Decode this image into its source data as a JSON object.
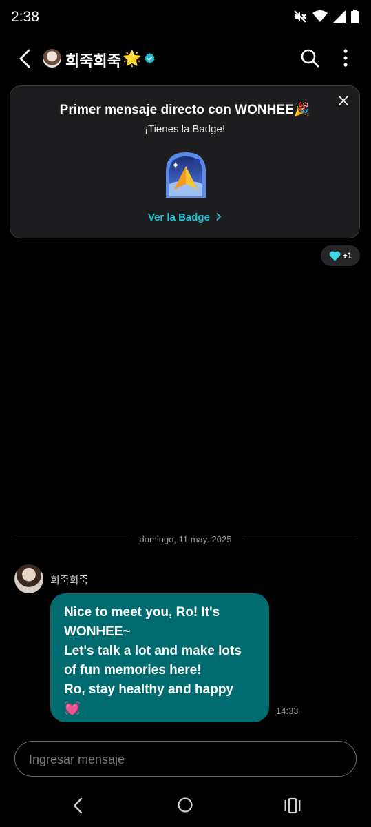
{
  "status_bar": {
    "time": "2:38",
    "icons": [
      "mute-icon",
      "wifi-icon",
      "signal-icon",
      "battery-icon"
    ]
  },
  "header": {
    "title": "희죽희죽",
    "title_emoji": "🌟",
    "icons": [
      "back-icon",
      "verified-icon",
      "search-icon",
      "more-vertical-icon"
    ]
  },
  "badge_card": {
    "title": "Primer mensaje directo con WONHEE🎉",
    "subtitle": "¡Tienes la Badge!",
    "link_label": "Ver la Badge",
    "link_color": "#20c6d6",
    "badge_icon": "paper-plane-badge-icon"
  },
  "reaction": {
    "emoji_icon": "heart-icon",
    "emoji_color": "#3fd6e6",
    "count": "+1"
  },
  "date_divider": "domingo, 11 may. 2025",
  "message": {
    "sender": "희죽희죽",
    "text": "Nice to meet you, Ro! It's\nWONHEE~\nLet's talk a lot and make lots\nof fun memories here!\nRo, stay healthy and happy\n💓",
    "time": "14:33",
    "bubble_color": "#006b6e"
  },
  "composer": {
    "placeholder": "Ingresar mensaje"
  },
  "nav_bar": {
    "icons": [
      "nav-back-icon",
      "nav-home-icon",
      "nav-recents-icon"
    ]
  }
}
